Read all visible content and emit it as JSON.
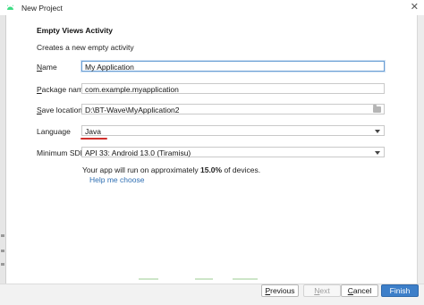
{
  "window": {
    "title": "New Project",
    "accent_color": "#3d7fc9",
    "icon": "android-icon"
  },
  "form": {
    "heading": "Empty Views Activity",
    "subheading": "Creates a new empty activity",
    "name": {
      "mnemonic": "N",
      "rest": "ame",
      "value": "My Application"
    },
    "package_name": {
      "mnemonic": "P",
      "rest": "ackage name",
      "value": "com.example.myapplication"
    },
    "save_location": {
      "mnemonic": "S",
      "rest": "ave location",
      "value": "D:\\BT-Wave\\MyApplication2"
    },
    "language": {
      "label": "Language",
      "value": "Java"
    },
    "minimum_sdk": {
      "label": "Minimum SDK",
      "value": "API 33: Android 13.0 (Tiramisu)"
    },
    "info_prefix": "Your app will run on approximately ",
    "info_percent": "15.0%",
    "info_suffix": " of devices.",
    "help_link": "Help me choose"
  },
  "buttons": {
    "previous": {
      "mnemonic": "P",
      "rest": "revious"
    },
    "next": {
      "mnemonic": "N",
      "rest": "ext"
    },
    "cancel": {
      "mnemonic": "C",
      "rest": "ancel"
    },
    "finish": "Finish"
  }
}
